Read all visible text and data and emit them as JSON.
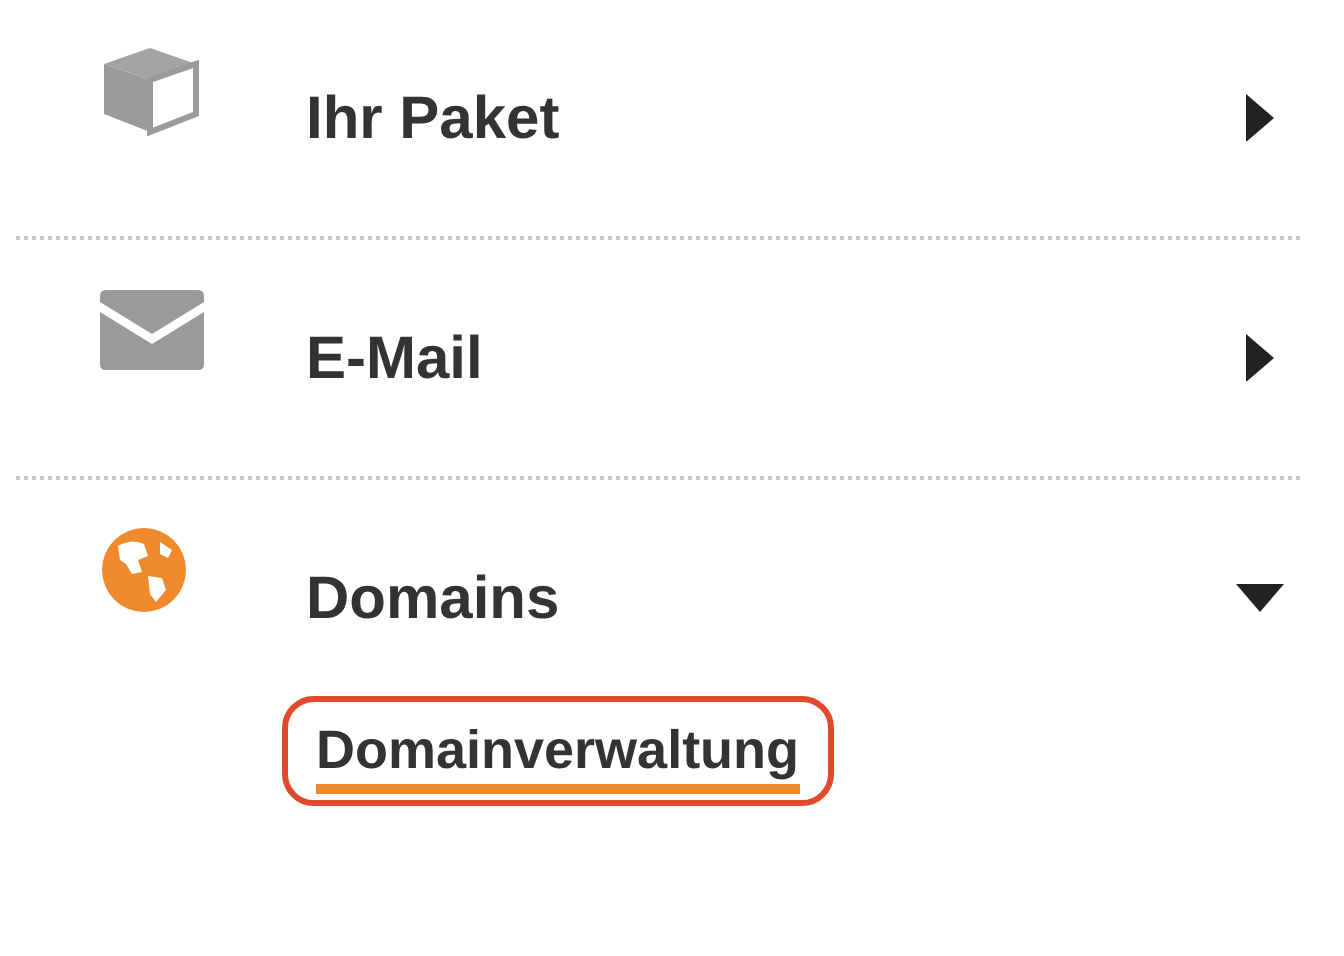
{
  "menu": [
    {
      "label": "Ihr Paket",
      "kind": "box",
      "expanded": false
    },
    {
      "label": "E-Mail",
      "kind": "mail",
      "expanded": false
    },
    {
      "label": "Domains",
      "kind": "globe",
      "expanded": true,
      "children": [
        {
          "label": "Domainverwaltung",
          "selected": true,
          "highlighted": true
        }
      ]
    }
  ]
}
